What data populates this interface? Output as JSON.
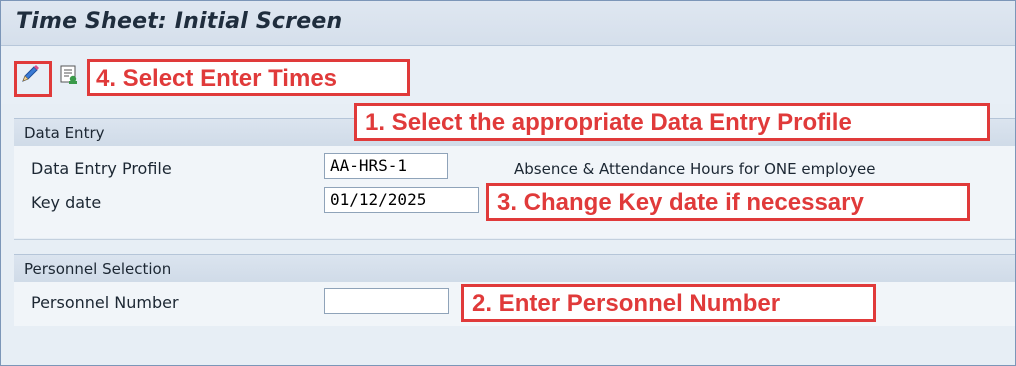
{
  "window": {
    "title": "Time Sheet: Initial Screen"
  },
  "toolbar": {
    "enter_times_icon": "pencil-icon",
    "other_icon": "overview-icon"
  },
  "callouts": {
    "step4": "4. Select Enter Times",
    "step1": "1. Select the appropriate Data Entry Profile",
    "step3": "3. Change Key date if necessary",
    "step2": "2. Enter Personnel Number"
  },
  "data_entry": {
    "section_title": "Data Entry",
    "profile_label": "Data Entry Profile",
    "profile_value": "AA-HRS-1",
    "profile_description": "Absence & Attendance Hours for ONE employee",
    "key_date_label": "Key date",
    "key_date_value": "01/12/2025"
  },
  "personnel_selection": {
    "section_title": "Personnel Selection",
    "number_label": "Personnel Number",
    "number_value": ""
  },
  "colors": {
    "callout_red": "#e03a3a",
    "title_bar": "#dfe7f1",
    "section_header": "#d5dfeb"
  }
}
